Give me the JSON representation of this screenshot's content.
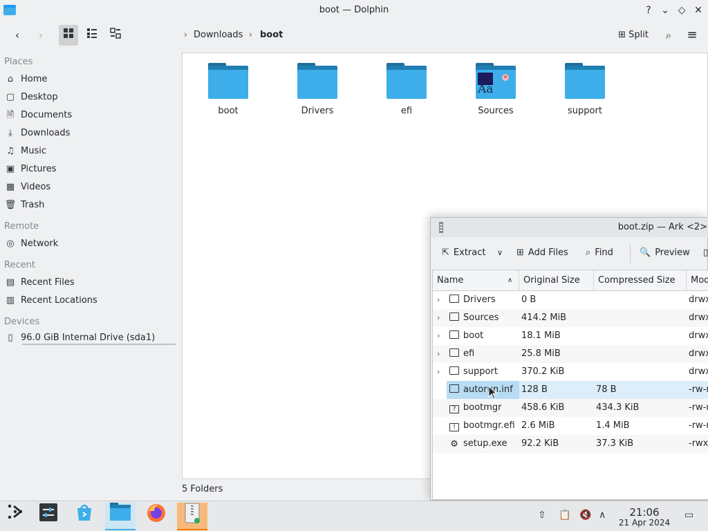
{
  "dolphin": {
    "title": "boot — Dolphin",
    "window_buttons": {
      "help": "?",
      "minimize": "⌄",
      "maximize": "◇",
      "close": "✕"
    },
    "toolbar": {
      "split_label": "Split"
    },
    "breadcrumb": [
      "Downloads",
      "boot"
    ],
    "places": {
      "sections": [
        "Places",
        "Remote",
        "Recent",
        "Devices"
      ],
      "places_items": [
        "Home",
        "Desktop",
        "Documents",
        "Downloads",
        "Music",
        "Pictures",
        "Videos",
        "Trash"
      ],
      "remote_items": [
        "Network"
      ],
      "recent_items": [
        "Recent Files",
        "Recent Locations"
      ],
      "device_items": [
        "96.0 GiB Internal Drive (sda1)"
      ]
    },
    "folders": [
      "boot",
      "Drivers",
      "efi",
      "Sources",
      "support"
    ],
    "status": "5 Folders"
  },
  "ark": {
    "title": "boot.zip — Ark <2>",
    "toolbar": {
      "extract": "Extract",
      "add_files": "Add Files",
      "find": "Find",
      "preview": "Preview"
    },
    "columns": [
      "Name",
      "Original Size",
      "Compressed Size",
      "Mod"
    ],
    "rows": [
      {
        "name": "Drivers",
        "original": "0 B",
        "compressed": "",
        "mod": "drwx"
      },
      {
        "name": "Sources",
        "original": "414.2 MiB",
        "compressed": "",
        "mod": "drwx"
      },
      {
        "name": "boot",
        "original": "18.1 MiB",
        "compressed": "",
        "mod": "drwx"
      },
      {
        "name": "efi",
        "original": "25.8 MiB",
        "compressed": "",
        "mod": "drwx"
      },
      {
        "name": "support",
        "original": "370.2 KiB",
        "compressed": "",
        "mod": "drwx"
      },
      {
        "name": "autorun.inf",
        "original": "128 B",
        "compressed": "78 B",
        "mod": "-rw-r"
      },
      {
        "name": "bootmgr",
        "original": "458.6 KiB",
        "compressed": "434.3 KiB",
        "mod": "-rw-r"
      },
      {
        "name": "bootmgr.efi",
        "original": "2.6 MiB",
        "compressed": "1.4 MiB",
        "mod": "-rw-r"
      },
      {
        "name": "setup.exe",
        "original": "92.2 KiB",
        "compressed": "37.3 KiB",
        "mod": "-rwxr"
      }
    ]
  },
  "taskbar": {
    "time": "21:06",
    "date": "21 Apr 2024"
  },
  "colors": {
    "accent": "#3daee9",
    "folder": "#3daee9",
    "selection": "#b8dcf3"
  }
}
